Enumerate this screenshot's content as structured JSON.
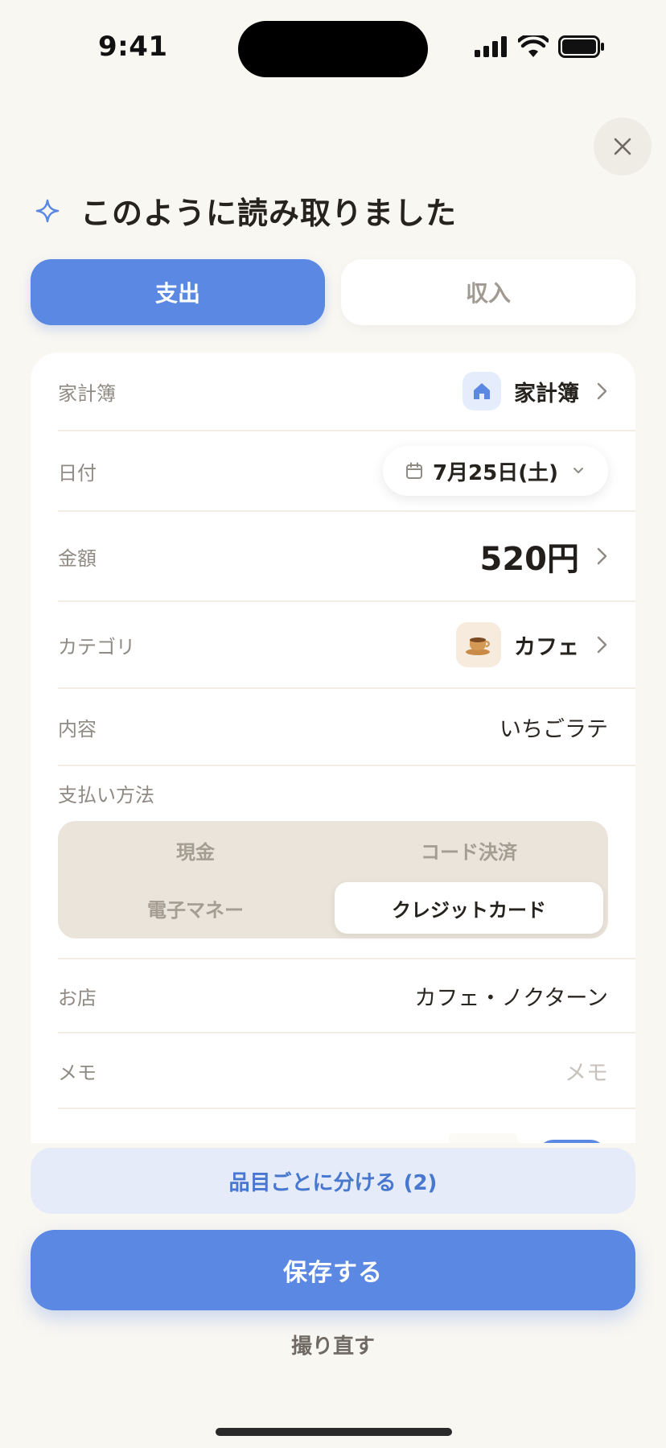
{
  "status_bar": {
    "time": "9:41"
  },
  "header": {
    "title": "このように読み取りました"
  },
  "tabs": [
    {
      "label": "支出",
      "active": true
    },
    {
      "label": "収入",
      "active": false
    }
  ],
  "form": {
    "book": {
      "label": "家計簿",
      "value": "家計簿",
      "icon": "house-icon"
    },
    "date": {
      "label": "日付",
      "value": "7月25日(土)"
    },
    "amount": {
      "label": "金額",
      "value": "520円"
    },
    "category": {
      "label": "カテゴリ",
      "value": "カフェ",
      "icon": "coffee-cup-icon"
    },
    "content": {
      "label": "内容",
      "value": "いちごラテ"
    },
    "payment": {
      "label": "支払い方法",
      "options": [
        "現金",
        "コード決済",
        "電子マネー",
        "クレジットカード"
      ],
      "selected": "クレジットカード"
    },
    "store": {
      "label": "お店",
      "value": "カフェ・ノクターン"
    },
    "memo": {
      "label": "メモ",
      "placeholder": "メモ"
    }
  },
  "actions": {
    "split_label": "品目ごとに分ける (2)",
    "save_label": "保存する",
    "retake_label": "撮り直す"
  },
  "colors": {
    "accent": "#5b88e3",
    "background": "#f9f7f2",
    "card": "#ffffff",
    "segment_bg": "#ebe4da"
  }
}
